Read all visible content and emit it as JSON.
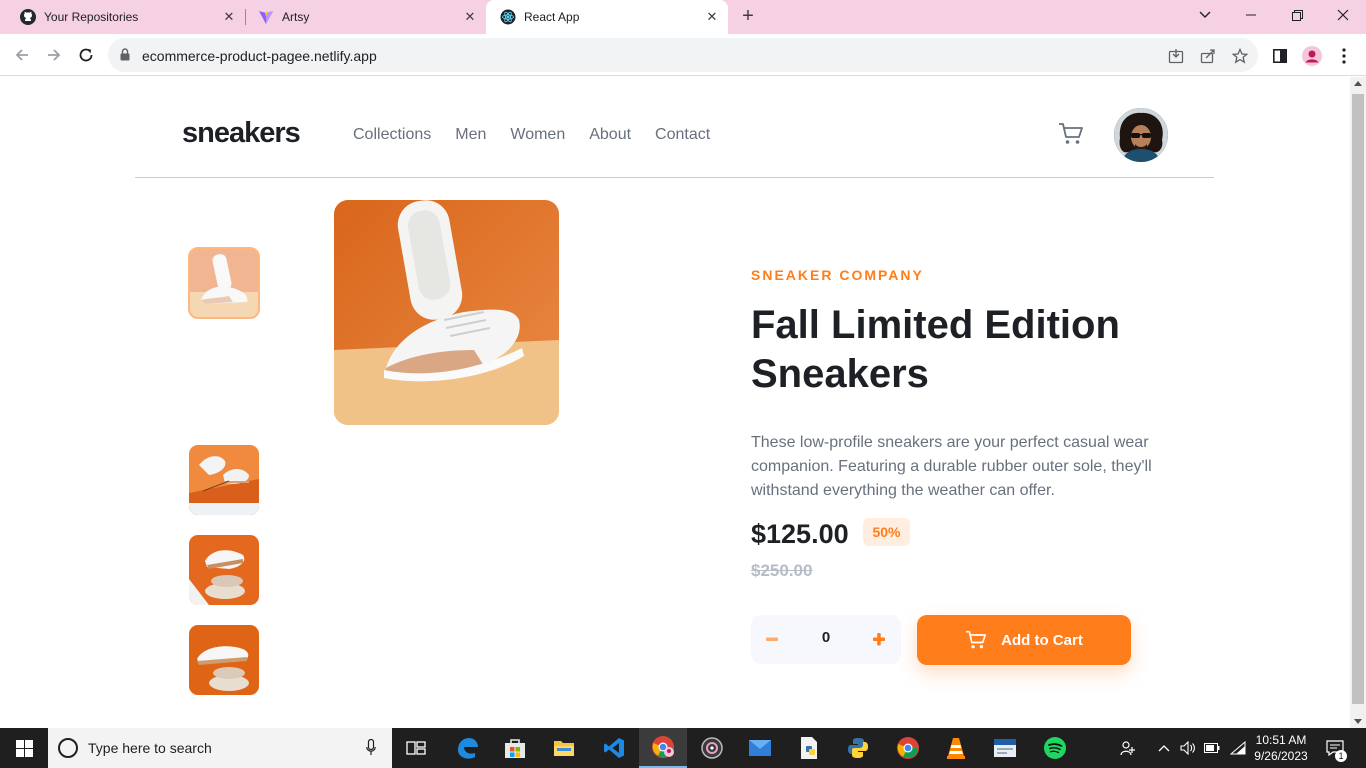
{
  "browser": {
    "tabs": [
      {
        "title": "Your Repositories",
        "icon": "github-icon"
      },
      {
        "title": "Artsy",
        "icon": "vite-icon"
      },
      {
        "title": "React App",
        "icon": "react-icon",
        "active": true
      }
    ],
    "url": "ecommerce-product-pagee.netlify.app"
  },
  "site": {
    "logo": "sneakers",
    "nav": [
      "Collections",
      "Men",
      "Women",
      "About",
      "Contact"
    ]
  },
  "product": {
    "company": "SNEAKER COMPANY",
    "title": "Fall Limited Edition Sneakers",
    "description": "These low-profile sneakers are your perfect casual wear companion. Featuring a durable rubber outer sole, they'll withstand everything the weather can offer.",
    "price": "$125.00",
    "discount": "50%",
    "old_price": "$250.00",
    "quantity": "0",
    "add_to_cart": "Add to Cart"
  },
  "colors": {
    "accent": "#ff7d1a",
    "accent_pale": "#ffede0",
    "dark": "#1d2025",
    "muted": "#69707d"
  },
  "taskbar": {
    "search_placeholder": "Type here to search",
    "time": "10:51 AM",
    "date": "9/26/2023",
    "notification_count": "1"
  }
}
